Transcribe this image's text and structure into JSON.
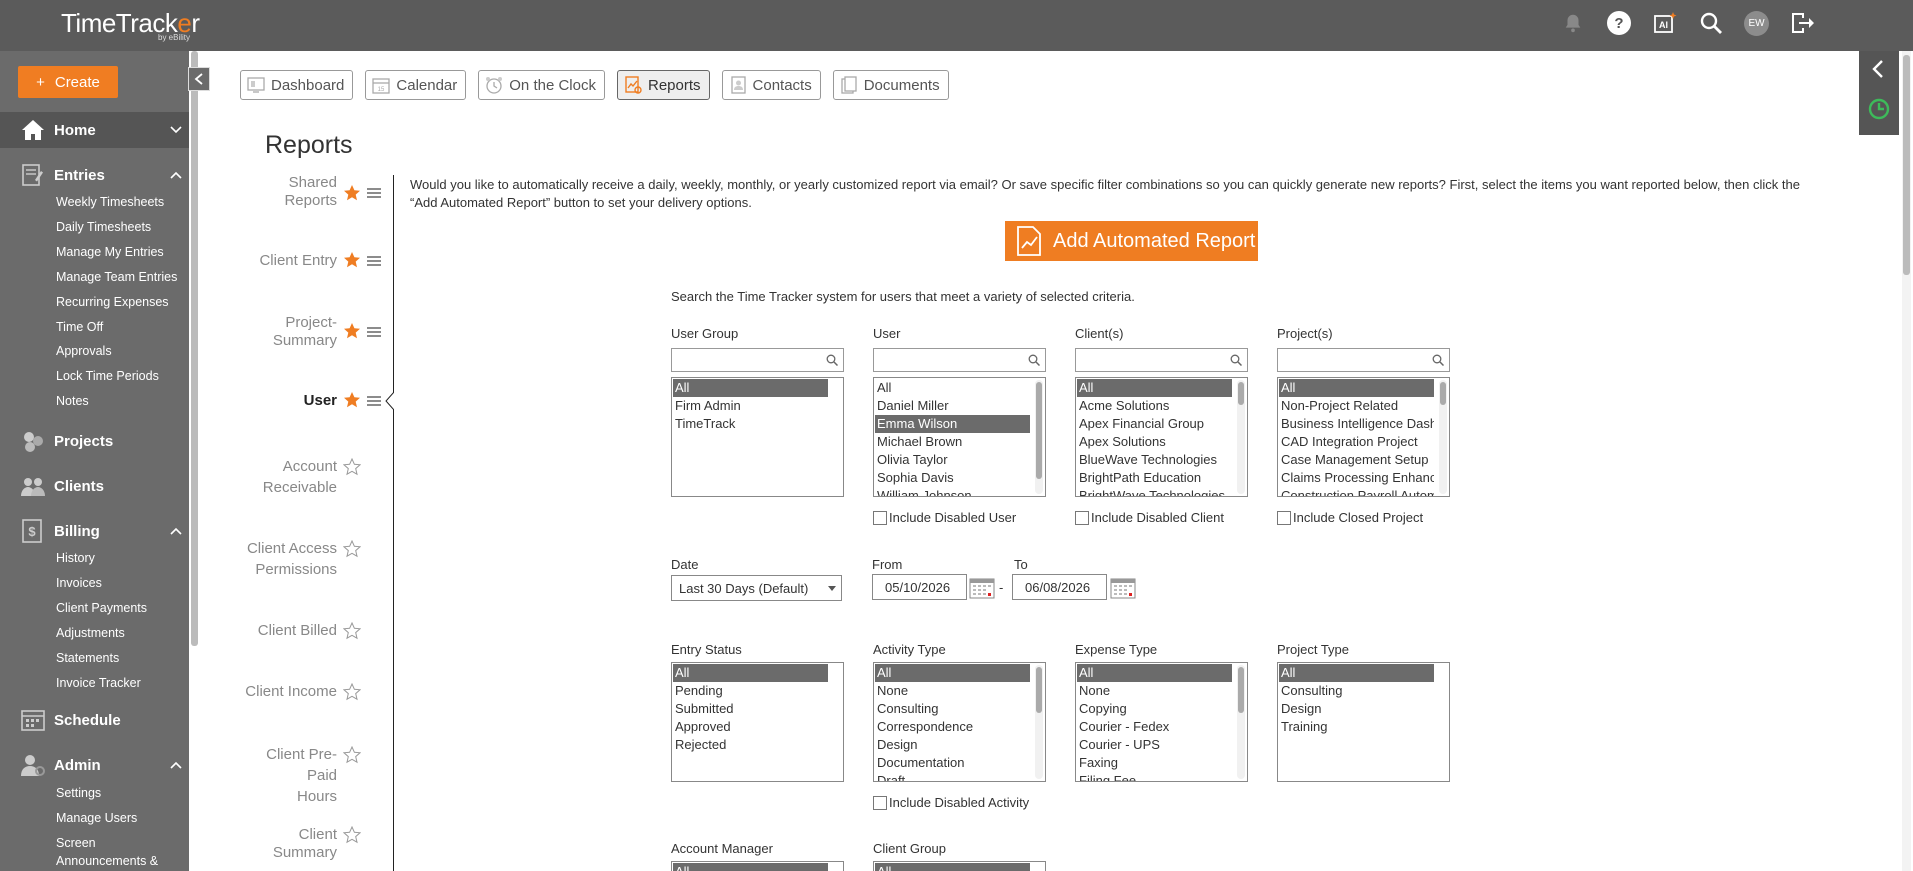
{
  "app": {
    "logo_text_a": "TimeTrack",
    "logo_text_o": "e",
    "logo_text_b": "r",
    "logo_sub": "by eBility"
  },
  "topbar": {
    "avatar_initials": "EW"
  },
  "sidebar": {
    "create_label": "Create",
    "sections": [
      {
        "label": "Home"
      },
      {
        "label": "Entries",
        "items": [
          "Weekly Timesheets",
          "Daily Timesheets",
          "Manage My Entries",
          "Manage Team Entries",
          "Recurring Expenses",
          "Time Off",
          "Approvals",
          "Lock Time Periods",
          "Notes"
        ]
      },
      {
        "label": "Projects"
      },
      {
        "label": "Clients"
      },
      {
        "label": "Billing",
        "items": [
          "History",
          "Invoices",
          "Client Payments",
          "Adjustments",
          "Statements",
          "Invoice Tracker"
        ]
      },
      {
        "label": "Schedule"
      },
      {
        "label": "Admin",
        "items": [
          "Settings",
          "Manage Users",
          "Screen",
          "Announcements &"
        ]
      }
    ]
  },
  "tabs": [
    "Dashboard",
    "Calendar",
    "On the Clock",
    "Reports",
    "Contacts",
    "Documents"
  ],
  "page_title": "Reports",
  "report_list": [
    {
      "line1": "Shared",
      "line2": "Reports"
    },
    {
      "line1": "Client Entry",
      "line2": ""
    },
    {
      "line1": "Project-",
      "line2": "Summary"
    },
    {
      "line1": "User",
      "line2": ""
    },
    {
      "line1": "Account",
      "line2": "Receivable"
    },
    {
      "line1": "Client Access",
      "line2": "Permissions"
    },
    {
      "line1": "Client Billed",
      "line2": ""
    },
    {
      "line1": "Client Income",
      "line2": ""
    },
    {
      "line1": "Client Pre-Paid",
      "line2": "Hours"
    },
    {
      "line1": "Client Summary",
      "line2": ""
    }
  ],
  "intro_text": "Would you like to automatically receive a daily, weekly, monthly, or yearly customized report via email? Or save specific filter combinations so you can quickly generate new reports? First, select the items you want reported below, then click the “Add Automated Report” button to set your delivery options.",
  "add_automated_label": "Add Automated Report",
  "search_hint": "Search the Time Tracker system for users that meet a variety of selected criteria.",
  "filters": {
    "user_group": {
      "label": "User Group",
      "options": [
        "All",
        "Firm Admin",
        "TimeTrack"
      ]
    },
    "user": {
      "label": "User",
      "options": [
        "All",
        "Daniel Miller",
        "Emma Wilson",
        "Michael Brown",
        "Olivia Taylor",
        "Sophia Davis",
        "William Johnson"
      ],
      "checkbox": "Include Disabled User"
    },
    "clients": {
      "label": "Client(s)",
      "options": [
        "All",
        "Acme Solutions",
        "Apex Financial Group",
        "Apex Solutions",
        "BlueWave Technologies",
        "BrightPath Education",
        "BrightWave Technologies"
      ],
      "checkbox": "Include Disabled Client"
    },
    "projects": {
      "label": "Project(s)",
      "options": [
        "All",
        "Non-Project Related",
        "Business Intelligence Dashb",
        "CAD Integration Project",
        "Case Management Setup",
        "Claims Processing Enhancer",
        "Construction Payroll Autom"
      ],
      "checkbox": "Include Closed Project"
    },
    "date": {
      "label": "Date",
      "value": "Last 30 Days (Default)"
    },
    "from": {
      "label": "From",
      "value": "05/10/2026"
    },
    "to": {
      "label": "To",
      "value": "06/08/2026"
    },
    "dash": "-",
    "entry_status": {
      "label": "Entry Status",
      "options": [
        "All",
        "Pending",
        "Submitted",
        "Approved",
        "Rejected"
      ]
    },
    "activity_type": {
      "label": "Activity Type",
      "options": [
        "All",
        "None",
        "Consulting",
        "Correspondence",
        "Design",
        "Documentation",
        "Draft"
      ],
      "checkbox": "Include Disabled Activity"
    },
    "expense_type": {
      "label": "Expense Type",
      "options": [
        "All",
        "None",
        "Copying",
        "Courier - Fedex",
        "Courier - UPS",
        "Faxing",
        "Filing Fee"
      ]
    },
    "project_type": {
      "label": "Project Type",
      "options": [
        "All",
        "Consulting",
        "Design",
        "Training"
      ]
    },
    "account_manager": {
      "label": "Account Manager",
      "options": [
        "All"
      ]
    },
    "client_group": {
      "label": "Client Group",
      "options": [
        "All"
      ]
    }
  },
  "colors": {
    "accent": "#ef7d22",
    "sidebar": "#6b6b6b",
    "topbar": "#5b5b5b"
  }
}
